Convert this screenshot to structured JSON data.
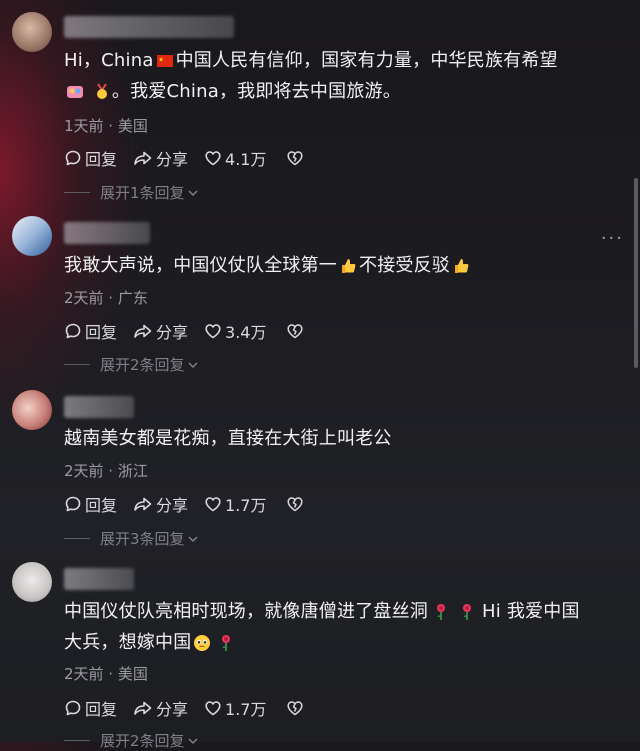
{
  "comments": [
    {
      "text_a": "Hi，China",
      "text_b": "中国人民有信仰，国家有力量，中华民族有希望",
      "text_c": "。我爱China，我即将去中国旅游。",
      "meta": "1天前 · 美国",
      "reply": "回复",
      "share": "分享",
      "likes": "4.1万",
      "expand": "展开1条回复"
    },
    {
      "text_a": "我敢大声说，中国仪仗队全球第一",
      "text_b": "不接受反驳",
      "meta": "2天前 · 广东",
      "reply": "回复",
      "share": "分享",
      "likes": "3.4万",
      "expand": "展开2条回复"
    },
    {
      "text_a": "越南美女都是花痴，直接在大街上叫老公",
      "meta": "2天前 · 浙江",
      "reply": "回复",
      "share": "分享",
      "likes": "1.7万",
      "expand": "展开3条回复"
    },
    {
      "text_a": "中国仪仗队亮相时现场，就像唐僧进了盘丝洞",
      "text_b": "Hi 我爱中国",
      "text_c": "大兵，想嫁中国",
      "meta": "2天前 · 美国",
      "reply": "回复",
      "share": "分享",
      "likes": "1.7万",
      "expand": "展开2条回复"
    }
  ],
  "more_menu": "···",
  "icons": {
    "reply": "reply-bubble-icon",
    "share": "share-arrow-icon",
    "like": "heart-icon",
    "dislike": "broken-heart-icon",
    "expand": "chevron-down-icon"
  }
}
